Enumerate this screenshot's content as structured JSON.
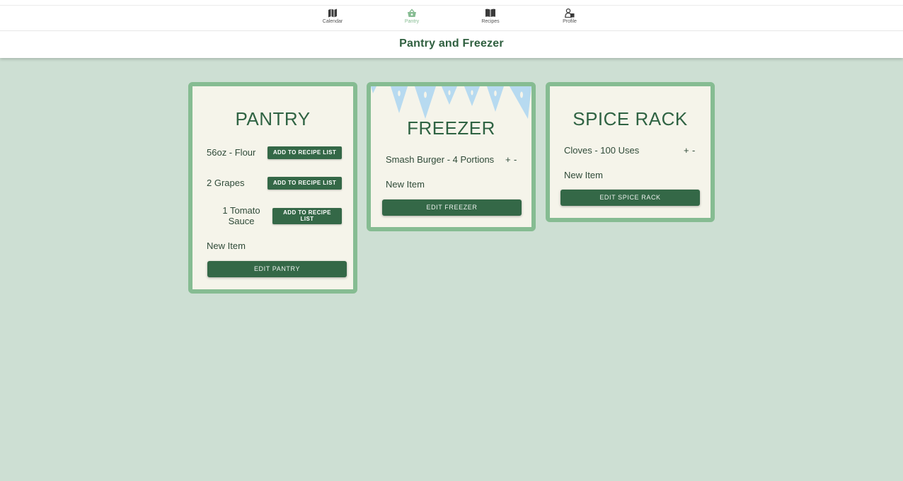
{
  "nav": {
    "tabs": [
      {
        "label": "Calendar",
        "icon": "map-icon"
      },
      {
        "label": "Pantry",
        "icon": "basket-icon"
      },
      {
        "label": "Recipes",
        "icon": "book-icon"
      },
      {
        "label": "Profile",
        "icon": "profile-icon"
      }
    ],
    "active_tab": "Pantry",
    "active_color": "#86bc92"
  },
  "page_title": "Pantry and Freezer",
  "pantry": {
    "title": "PANTRY",
    "items": [
      {
        "label": "56oz - Flour",
        "button": "ADD TO RECIPE LIST"
      },
      {
        "label": "2 Grapes",
        "button": "ADD TO RECIPE LIST"
      },
      {
        "label": "1 Tomato Sauce",
        "line1": "1 Tomato",
        "line2": "Sauce",
        "button": "ADD TO RECIPE LIST",
        "button_line1": "ADD TO RECIPE",
        "button_line2": "LIST"
      }
    ],
    "new_item": "New Item",
    "edit_button": "EDIT PANTRY"
  },
  "freezer": {
    "title": "FREEZER",
    "items": [
      {
        "label": "Smash Burger - 4 Portions",
        "plus": "+",
        "minus": "-"
      }
    ],
    "new_item": "New Item",
    "edit_button": "EDIT FREEZER"
  },
  "spice_rack": {
    "title": "SPICE RACK",
    "items": [
      {
        "label": "Cloves - 100 Uses",
        "plus": "+",
        "minus": "-"
      }
    ],
    "new_item": "New Item",
    "edit_button": "EDIT SPICE RACK"
  },
  "colors": {
    "background": "#cddfd3",
    "card_border": "#86bc92",
    "card_fill": "#f5f4ea",
    "button": "#346847",
    "title_text": "#2f6343",
    "icicle": "#b7daf0"
  }
}
